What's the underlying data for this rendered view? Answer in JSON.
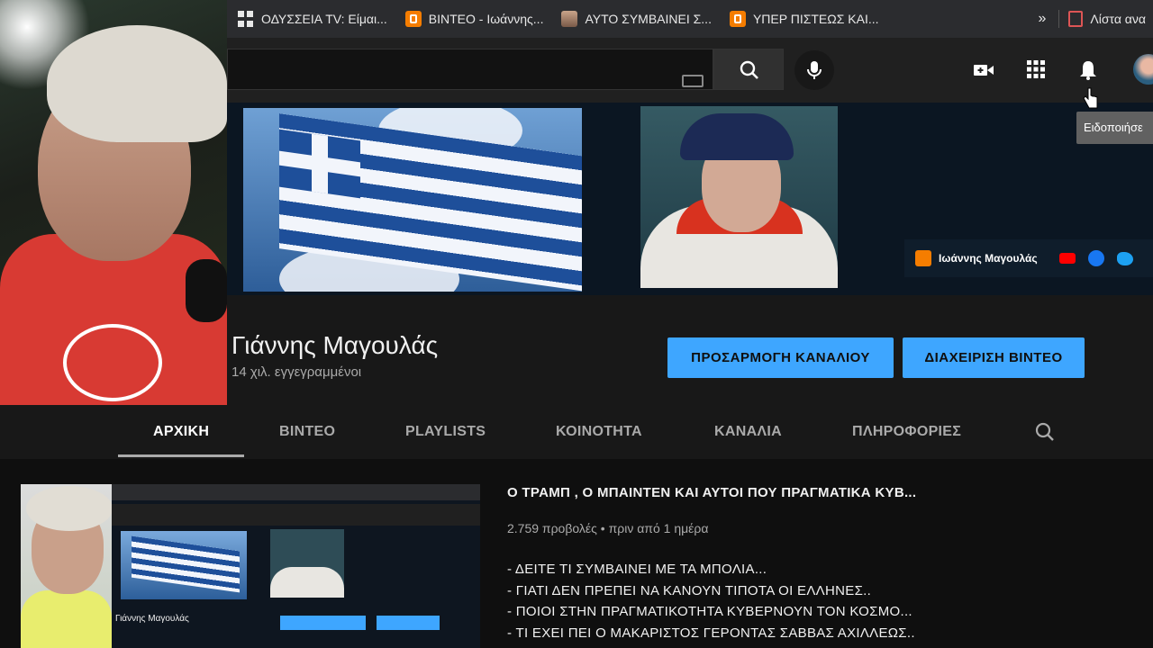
{
  "bookmarks": [
    {
      "label": "ΟΔΥΣΣΕΙΑ TV: Είμαι...",
      "icon": "apps-grid-icon"
    },
    {
      "label": "ΒΙΝΤΕΟ - Ιωάννης...",
      "icon": "blogger-icon"
    },
    {
      "label": "ΑΥΤΟ ΣΥΜΒΑΙΝΕΙ Σ...",
      "icon": "profile-photo-icon"
    },
    {
      "label": "ΥΠΕΡ ΠΙΣΤΕΩΣ ΚΑΙ...",
      "icon": "blogger-icon"
    }
  ],
  "bookmarks_more": "»",
  "reading_list": "Λίστα ανα",
  "tooltip": "Ειδοποιήσε",
  "banner": {
    "author": "Ιωάννης Μαγουλάς"
  },
  "channel": {
    "name": "Γιάννης Μαγουλάς",
    "subscribers": "14 χιλ. εγγεγραμμένοι",
    "customize_label": "ΠΡΟΣΑΡΜΟΓΗ ΚΑΝΑΛΙΟΥ",
    "manage_label": "ΔΙΑΧΕΙΡΙΣΗ ΒΙΝΤΕΟ"
  },
  "tabs": [
    "ΑΡΧΙΚΗ",
    "ΒΙΝΤΕΟ",
    "PLAYLISTS",
    "ΚΟΙΝΟΤΗΤΑ",
    "ΚΑΝΑΛΙΑ",
    "ΠΛΗΡΟΦΟΡΙΕΣ"
  ],
  "active_tab": "ΑΡΧΙΚΗ",
  "featured": {
    "title": "Ο ΤΡΑΜΠ , Ο ΜΠΑΙΝΤΕΝ ΚΑΙ ΑΥΤΟΙ ΠΟΥ ΠΡΑΓΜΑΤΙΚΑ ΚΥΒ...",
    "views": "2.759 προβολές",
    "age": "πριν από 1 ημέρα",
    "description": [
      "- ΔΕΙΤΕ ΤΙ ΣΥΜΒΑΙΝΕΙ ΜΕ ΤΑ ΜΠΟΛΙΑ...",
      "- ΓΙΑΤΙ ΔΕΝ ΠΡΕΠΕΙ ΝΑ ΚΑΝΟΥΝ ΤΙΠΟΤΑ ΟΙ ΕΛΛΗΝΕΣ..",
      "- ΠΟΙΟΙ ΣΤΗΝ ΠΡΑΓΜΑΤΙΚΟΤΗΤΑ ΚΥΒΕΡΝΟΥΝ ΤΟΝ ΚΟΣΜΟ...",
      "- ΤΙ ΕΧΕΙ ΠΕΙ Ο ΜΑΚΑΡΙΣΤΟΣ ΓΕΡΟΝΤΑΣ ΣΑΒΒΑΣ ΑΧΙΛΛΕΩΣ.."
    ],
    "thumb_channel_name": "Γιάννης Μαγουλάς"
  },
  "colors": {
    "accent": "#3ea6ff",
    "background": "#181818",
    "surface": "#202020"
  }
}
